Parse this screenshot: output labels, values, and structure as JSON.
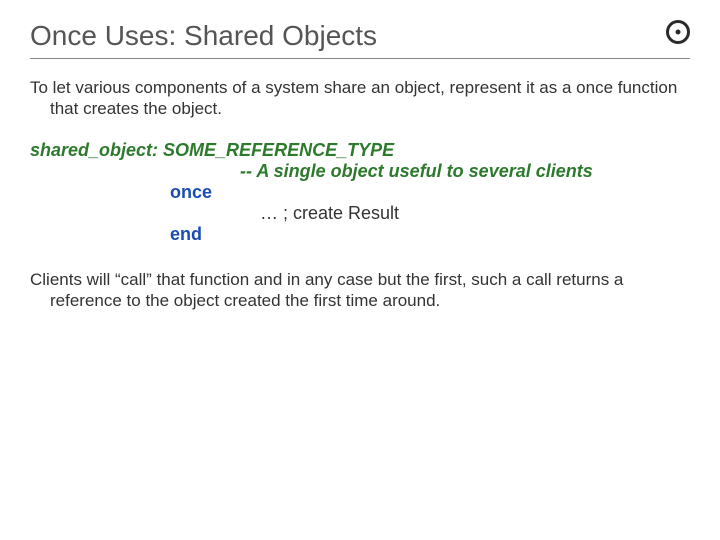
{
  "title": "Once Uses: Shared Objects",
  "intro": "To let various components of a system share an object, represent it as a once function that creates the object.",
  "code": {
    "signature": "shared_object: SOME_REFERENCE_TYPE",
    "comment": "-- A single object useful to several clients",
    "kw_once": "once",
    "body": "… ; create Result",
    "kw_end": "end"
  },
  "outro": "Clients will “call” that function and in any case but the first, such a call returns a reference to the object created the first time around.",
  "logo_name": "eiffel-logo"
}
